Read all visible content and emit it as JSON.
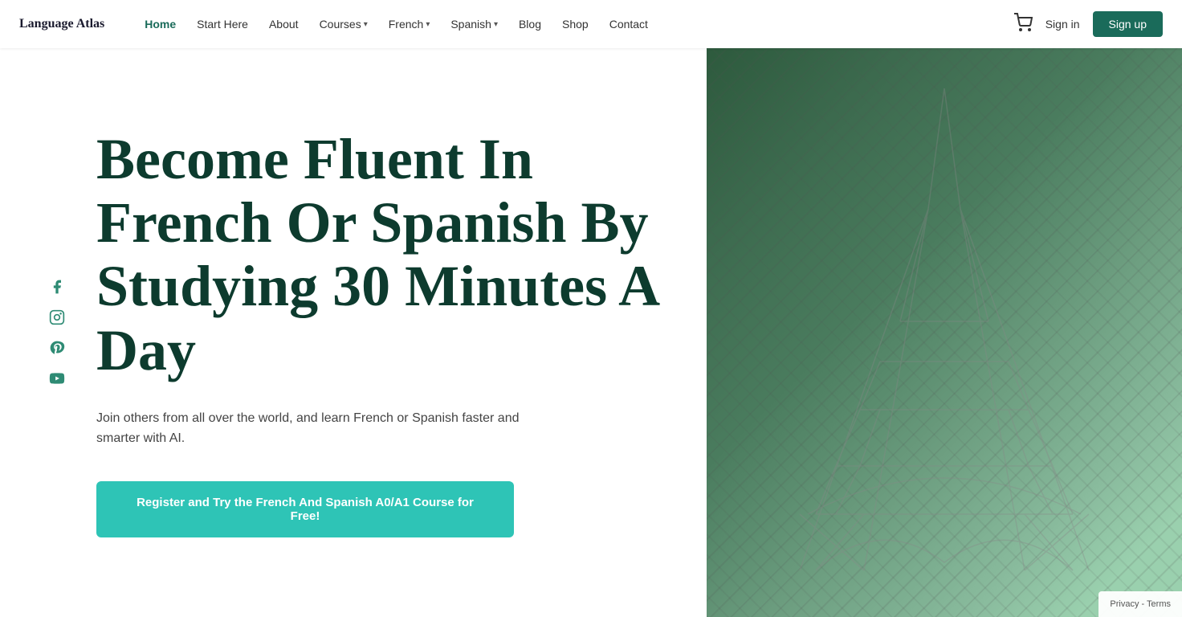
{
  "brand": {
    "name": "Language Atlas"
  },
  "nav": {
    "links": [
      {
        "id": "home",
        "label": "Home",
        "active": true,
        "dropdown": false
      },
      {
        "id": "start-here",
        "label": "Start Here",
        "active": false,
        "dropdown": false
      },
      {
        "id": "about",
        "label": "About",
        "active": false,
        "dropdown": false
      },
      {
        "id": "courses",
        "label": "Courses",
        "active": false,
        "dropdown": true
      },
      {
        "id": "french",
        "label": "French",
        "active": false,
        "dropdown": true
      },
      {
        "id": "spanish",
        "label": "Spanish",
        "active": false,
        "dropdown": true
      },
      {
        "id": "blog",
        "label": "Blog",
        "active": false,
        "dropdown": false
      },
      {
        "id": "shop",
        "label": "Shop",
        "active": false,
        "dropdown": false
      },
      {
        "id": "contact",
        "label": "Contact",
        "active": false,
        "dropdown": false
      }
    ],
    "sign_in": "Sign in",
    "sign_up": "Sign up"
  },
  "hero": {
    "title": "Become Fluent In French Or Spanish By Studying 30 Minutes A Day",
    "subtitle": "Join others from all over the world, and learn French or Spanish faster and smarter with AI.",
    "cta_label": "Register and Try the French And Spanish A0/A1 Course for Free!"
  },
  "social": [
    {
      "id": "facebook",
      "label": "Facebook"
    },
    {
      "id": "instagram",
      "label": "Instagram"
    },
    {
      "id": "pinterest",
      "label": "Pinterest"
    },
    {
      "id": "youtube",
      "label": "YouTube"
    }
  ],
  "cookie": {
    "text": "Privacy - Terms"
  }
}
